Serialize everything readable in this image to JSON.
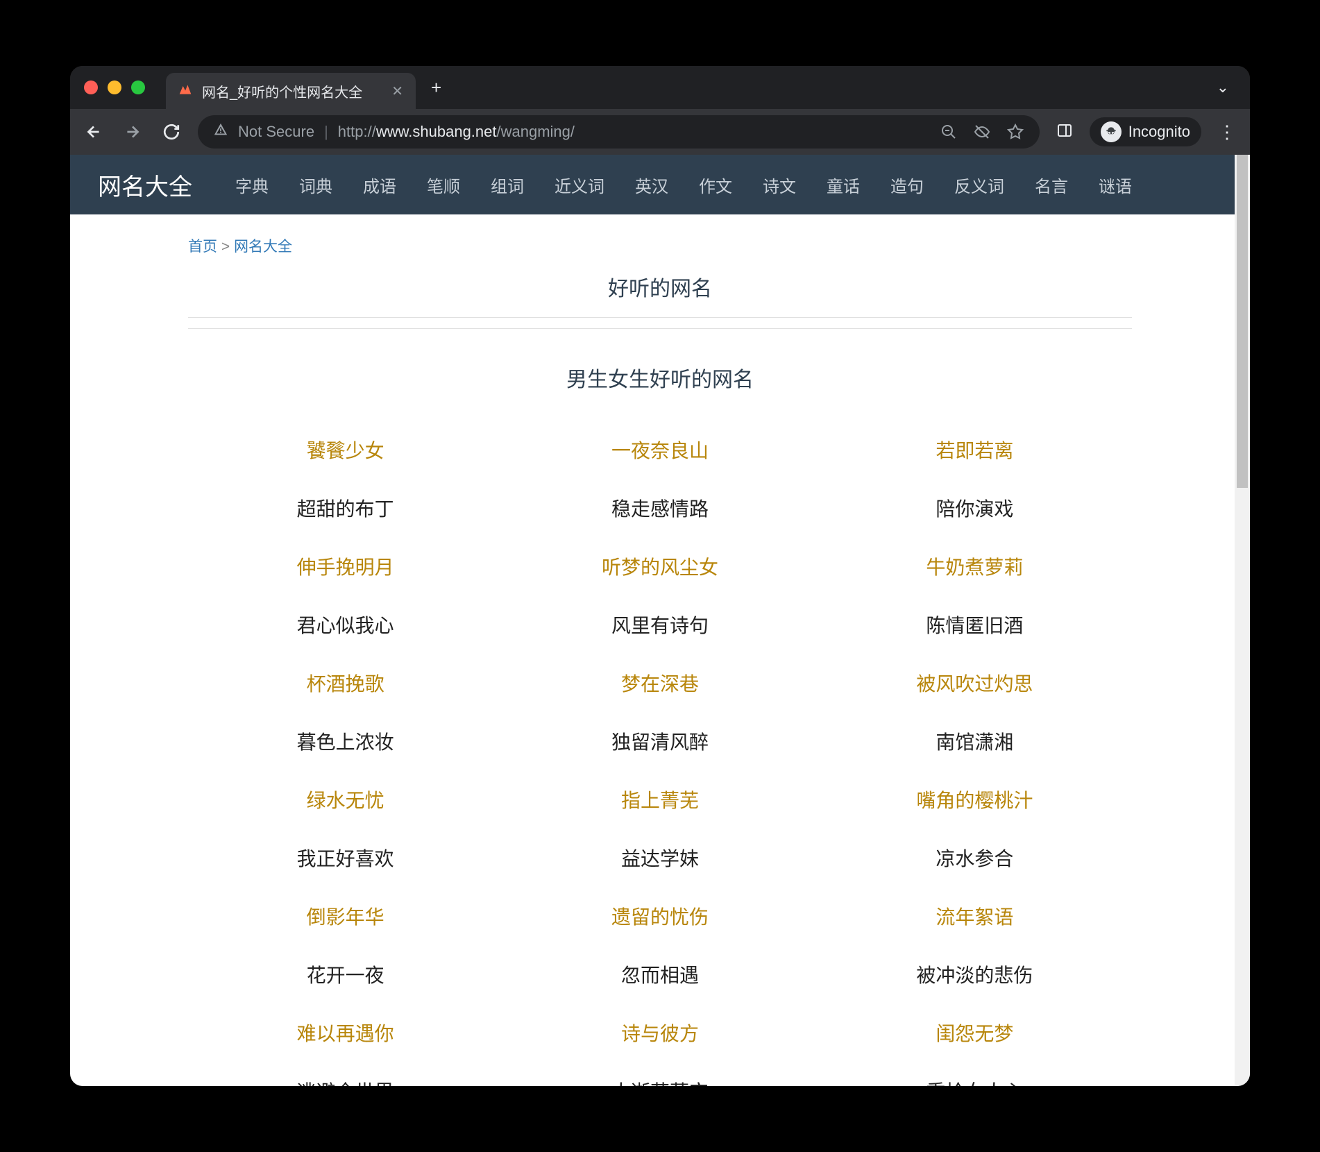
{
  "browser": {
    "tab_title": "网名_好听的个性网名大全",
    "new_tab_plus": "+",
    "chevron": "⌄",
    "not_secure": "Not Secure",
    "url_scheme": "http://",
    "url_host": "www.shubang.net",
    "url_path": "/wangming/",
    "incognito": "Incognito",
    "kebab": "⋮"
  },
  "nav": {
    "title": "网名大全",
    "links": [
      "字典",
      "词典",
      "成语",
      "笔顺",
      "组词",
      "近义词",
      "英汉",
      "作文",
      "诗文",
      "童话",
      "造句",
      "反义词",
      "名言",
      "谜语"
    ]
  },
  "breadcrumb": {
    "home": "首页",
    "sep": ">",
    "current": "网名大全"
  },
  "page_heading": "好听的网名",
  "section_heading": "男生女生好听的网名",
  "rows": [
    {
      "type": "link",
      "cols": [
        "饕餮少女",
        "一夜奈良山",
        "若即若离"
      ]
    },
    {
      "type": "plain",
      "cols": [
        "超甜的布丁",
        "稳走感情路",
        "陪你演戏"
      ]
    },
    {
      "type": "link",
      "cols": [
        "伸手挽明月",
        "听梦的风尘女",
        "牛奶煮萝莉"
      ]
    },
    {
      "type": "plain",
      "cols": [
        "君心似我心",
        "风里有诗句",
        "陈情匿旧酒"
      ]
    },
    {
      "type": "link",
      "cols": [
        "杯酒挽歌",
        "梦在深巷",
        "被风吹过灼思"
      ]
    },
    {
      "type": "plain",
      "cols": [
        "暮色上浓妆",
        "独留清风醉",
        "南馆潇湘"
      ]
    },
    {
      "type": "link",
      "cols": [
        "绿水无忧",
        "指上菁芜",
        "嘴角的樱桃汁"
      ]
    },
    {
      "type": "plain",
      "cols": [
        "我正好喜欢",
        "益达学妹",
        "凉水参合"
      ]
    },
    {
      "type": "link",
      "cols": [
        "倒影年华",
        "遗留的忧伤",
        "流年絮语"
      ]
    },
    {
      "type": "plain",
      "cols": [
        "花开一夜",
        "忽而相遇",
        "被冲淡的悲伤"
      ]
    },
    {
      "type": "link",
      "cols": [
        "难以再遇你",
        "诗与彼方",
        "闺怨无梦"
      ]
    },
    {
      "type": "plain",
      "cols": [
        "逃避全世界",
        "人逝花落空",
        "重拾女人心"
      ]
    }
  ]
}
